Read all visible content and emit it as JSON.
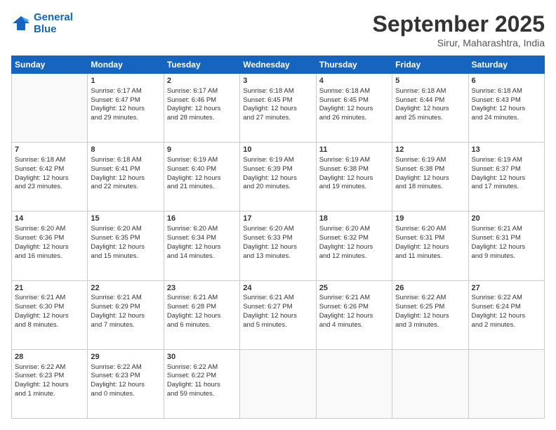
{
  "logo": {
    "line1": "General",
    "line2": "Blue"
  },
  "header": {
    "month": "September 2025",
    "location": "Sirur, Maharashtra, India"
  },
  "days": [
    "Sunday",
    "Monday",
    "Tuesday",
    "Wednesday",
    "Thursday",
    "Friday",
    "Saturday"
  ],
  "weeks": [
    [
      {
        "day": "",
        "info": ""
      },
      {
        "day": "1",
        "info": "Sunrise: 6:17 AM\nSunset: 6:47 PM\nDaylight: 12 hours\nand 29 minutes."
      },
      {
        "day": "2",
        "info": "Sunrise: 6:17 AM\nSunset: 6:46 PM\nDaylight: 12 hours\nand 28 minutes."
      },
      {
        "day": "3",
        "info": "Sunrise: 6:18 AM\nSunset: 6:45 PM\nDaylight: 12 hours\nand 27 minutes."
      },
      {
        "day": "4",
        "info": "Sunrise: 6:18 AM\nSunset: 6:45 PM\nDaylight: 12 hours\nand 26 minutes."
      },
      {
        "day": "5",
        "info": "Sunrise: 6:18 AM\nSunset: 6:44 PM\nDaylight: 12 hours\nand 25 minutes."
      },
      {
        "day": "6",
        "info": "Sunrise: 6:18 AM\nSunset: 6:43 PM\nDaylight: 12 hours\nand 24 minutes."
      }
    ],
    [
      {
        "day": "7",
        "info": "Sunrise: 6:18 AM\nSunset: 6:42 PM\nDaylight: 12 hours\nand 23 minutes."
      },
      {
        "day": "8",
        "info": "Sunrise: 6:18 AM\nSunset: 6:41 PM\nDaylight: 12 hours\nand 22 minutes."
      },
      {
        "day": "9",
        "info": "Sunrise: 6:19 AM\nSunset: 6:40 PM\nDaylight: 12 hours\nand 21 minutes."
      },
      {
        "day": "10",
        "info": "Sunrise: 6:19 AM\nSunset: 6:39 PM\nDaylight: 12 hours\nand 20 minutes."
      },
      {
        "day": "11",
        "info": "Sunrise: 6:19 AM\nSunset: 6:38 PM\nDaylight: 12 hours\nand 19 minutes."
      },
      {
        "day": "12",
        "info": "Sunrise: 6:19 AM\nSunset: 6:38 PM\nDaylight: 12 hours\nand 18 minutes."
      },
      {
        "day": "13",
        "info": "Sunrise: 6:19 AM\nSunset: 6:37 PM\nDaylight: 12 hours\nand 17 minutes."
      }
    ],
    [
      {
        "day": "14",
        "info": "Sunrise: 6:20 AM\nSunset: 6:36 PM\nDaylight: 12 hours\nand 16 minutes."
      },
      {
        "day": "15",
        "info": "Sunrise: 6:20 AM\nSunset: 6:35 PM\nDaylight: 12 hours\nand 15 minutes."
      },
      {
        "day": "16",
        "info": "Sunrise: 6:20 AM\nSunset: 6:34 PM\nDaylight: 12 hours\nand 14 minutes."
      },
      {
        "day": "17",
        "info": "Sunrise: 6:20 AM\nSunset: 6:33 PM\nDaylight: 12 hours\nand 13 minutes."
      },
      {
        "day": "18",
        "info": "Sunrise: 6:20 AM\nSunset: 6:32 PM\nDaylight: 12 hours\nand 12 minutes."
      },
      {
        "day": "19",
        "info": "Sunrise: 6:20 AM\nSunset: 6:31 PM\nDaylight: 12 hours\nand 11 minutes."
      },
      {
        "day": "20",
        "info": "Sunrise: 6:21 AM\nSunset: 6:31 PM\nDaylight: 12 hours\nand 9 minutes."
      }
    ],
    [
      {
        "day": "21",
        "info": "Sunrise: 6:21 AM\nSunset: 6:30 PM\nDaylight: 12 hours\nand 8 minutes."
      },
      {
        "day": "22",
        "info": "Sunrise: 6:21 AM\nSunset: 6:29 PM\nDaylight: 12 hours\nand 7 minutes."
      },
      {
        "day": "23",
        "info": "Sunrise: 6:21 AM\nSunset: 6:28 PM\nDaylight: 12 hours\nand 6 minutes."
      },
      {
        "day": "24",
        "info": "Sunrise: 6:21 AM\nSunset: 6:27 PM\nDaylight: 12 hours\nand 5 minutes."
      },
      {
        "day": "25",
        "info": "Sunrise: 6:21 AM\nSunset: 6:26 PM\nDaylight: 12 hours\nand 4 minutes."
      },
      {
        "day": "26",
        "info": "Sunrise: 6:22 AM\nSunset: 6:25 PM\nDaylight: 12 hours\nand 3 minutes."
      },
      {
        "day": "27",
        "info": "Sunrise: 6:22 AM\nSunset: 6:24 PM\nDaylight: 12 hours\nand 2 minutes."
      }
    ],
    [
      {
        "day": "28",
        "info": "Sunrise: 6:22 AM\nSunset: 6:23 PM\nDaylight: 12 hours\nand 1 minute."
      },
      {
        "day": "29",
        "info": "Sunrise: 6:22 AM\nSunset: 6:23 PM\nDaylight: 12 hours\nand 0 minutes."
      },
      {
        "day": "30",
        "info": "Sunrise: 6:22 AM\nSunset: 6:22 PM\nDaylight: 11 hours\nand 59 minutes."
      },
      {
        "day": "",
        "info": ""
      },
      {
        "day": "",
        "info": ""
      },
      {
        "day": "",
        "info": ""
      },
      {
        "day": "",
        "info": ""
      }
    ]
  ]
}
